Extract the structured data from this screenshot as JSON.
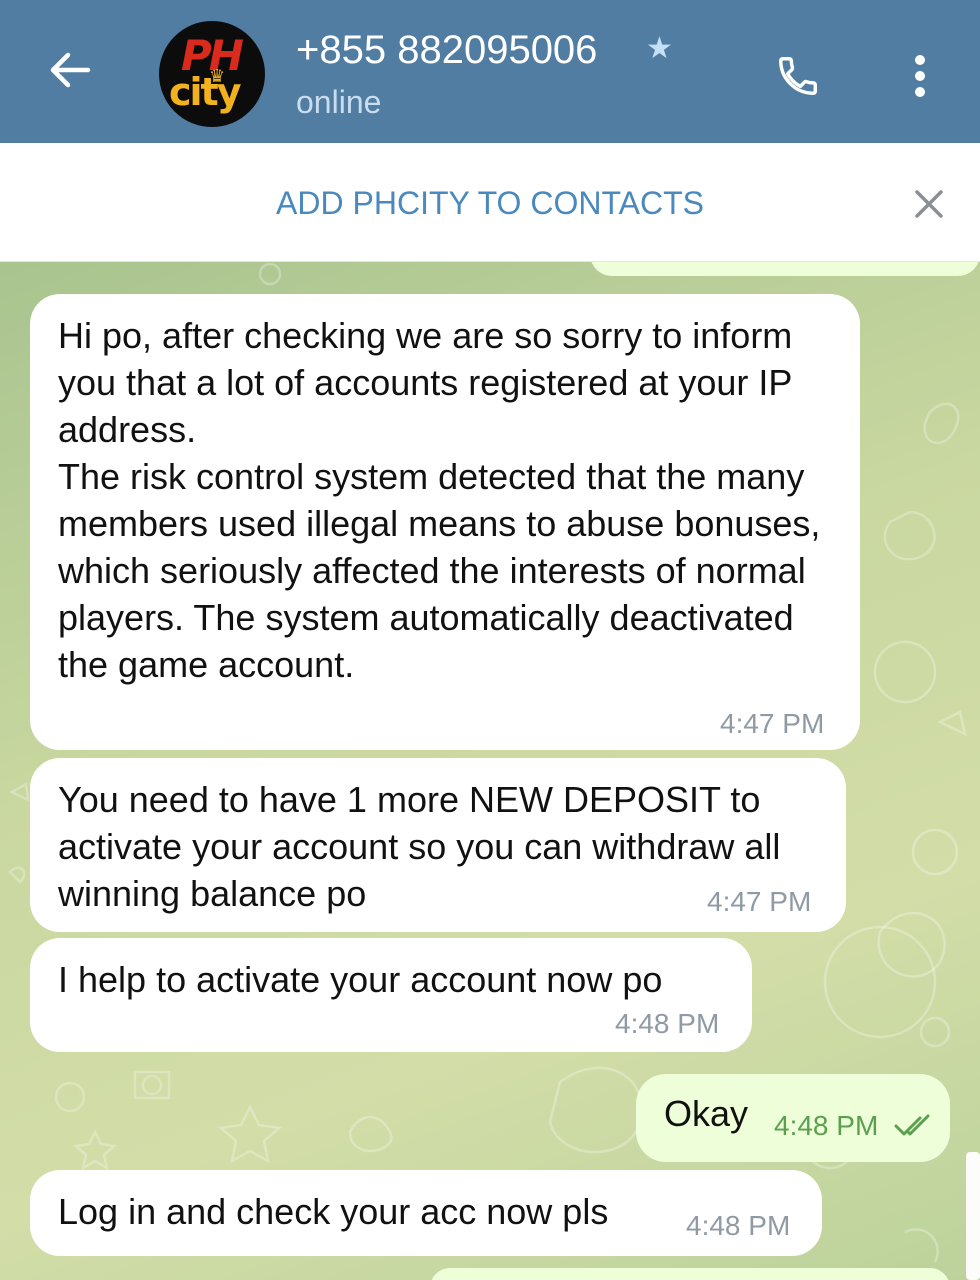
{
  "header": {
    "contact_name": "+855 882095006",
    "status": "online",
    "avatar_text_top": "PH",
    "avatar_text_bottom": "city",
    "icons": {
      "back": "arrow-left-icon",
      "star": "star-icon",
      "call": "phone-icon",
      "menu": "more-vert-icon"
    }
  },
  "add_contact_bar": {
    "label": "ADD PHCITY TO CONTACTS",
    "close_icon": "close-icon"
  },
  "messages": [
    {
      "direction": "in",
      "text": "Hi po, after checking we are so sorry to inform you that a lot of accounts registered at your IP address.\nThe risk control system detected that the many members used illegal means to abuse bonuses, which seriously affected the interests of normal players. The system automatically deactivated the game account.",
      "time": "4:47 PM"
    },
    {
      "direction": "in",
      "text": "You need to have 1 more NEW DEPOSIT to activate your account so you can withdraw all winning balance po",
      "time": "4:47 PM"
    },
    {
      "direction": "in",
      "text": "I help to activate your account now po",
      "time": "4:48 PM"
    },
    {
      "direction": "out",
      "text": "Okay",
      "time": "4:48 PM",
      "status_icon": "double-check-icon"
    },
    {
      "direction": "in",
      "text": "Log in and check your acc now pls",
      "time": "4:48 PM"
    }
  ],
  "colors": {
    "header_bg": "#517da2",
    "link": "#4a89bd",
    "incoming_bubble": "#ffffff",
    "outgoing_bubble": "#eefed9",
    "time_gray": "#8f9aa4",
    "time_green": "#59a14f"
  }
}
